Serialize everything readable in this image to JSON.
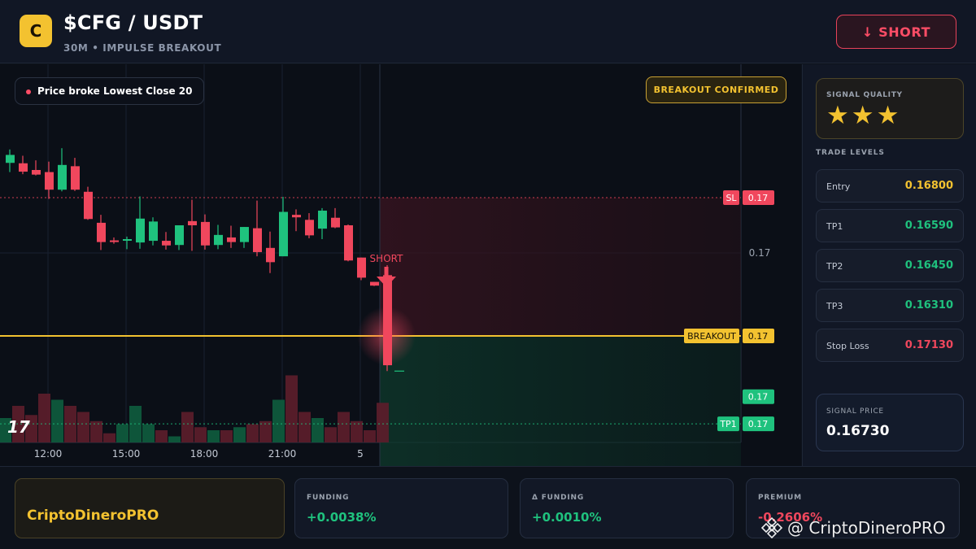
{
  "header": {
    "logo_letter": "C",
    "title": "$CFG / USDT",
    "subtitle": "30M • IMPULSE BREAKOUT",
    "short_button": "↓ SHORT"
  },
  "chart_overlay": {
    "pill_text": "Price broke Lowest Close 20",
    "confirmed_badge": "BREAKOUT CONFIRMED",
    "short_marker": "SHORT",
    "tv_logo": "17"
  },
  "colors": {
    "up": "#1fc27e",
    "down": "#f0475d",
    "breakout": "#f3c230",
    "background": "#0b0f17"
  },
  "chart_data": {
    "type": "candlestick",
    "x_ticks": [
      "12:00",
      "15:00",
      "18:00",
      "21:00",
      "5"
    ],
    "x_tick_index": [
      3,
      9,
      15,
      21,
      27
    ],
    "y_tick_label": "0.17",
    "levels": [
      {
        "name": "SL",
        "tag": "SL",
        "price_label": "0.17",
        "value": 0.1713
      },
      {
        "name": "Breakout",
        "tag": "BREAKOUT",
        "price_label": "0.17",
        "value": 0.168
      },
      {
        "name": "Last price",
        "tag": "",
        "price_label": "0.17",
        "value": 0.16655
      },
      {
        "name": "TP1",
        "tag": "TP1",
        "price_label": "0.17",
        "value": 0.1659
      }
    ],
    "candles": [
      {
        "o": 0.17213,
        "h": 0.17245,
        "l": 0.17191,
        "c": 0.17232,
        "v": 4
      },
      {
        "o": 0.17212,
        "h": 0.1723,
        "l": 0.17186,
        "c": 0.17192,
        "v": 6
      },
      {
        "o": 0.17196,
        "h": 0.17219,
        "l": 0.17183,
        "c": 0.17185,
        "v": 4.5
      },
      {
        "o": 0.17191,
        "h": 0.17216,
        "l": 0.17127,
        "c": 0.17149,
        "v": 8
      },
      {
        "o": 0.17149,
        "h": 0.17248,
        "l": 0.17145,
        "c": 0.17208,
        "v": 7
      },
      {
        "o": 0.17205,
        "h": 0.17225,
        "l": 0.17146,
        "c": 0.17149,
        "v": 6
      },
      {
        "o": 0.17144,
        "h": 0.17156,
        "l": 0.17077,
        "c": 0.17079,
        "v": 5
      },
      {
        "o": 0.1707,
        "h": 0.17089,
        "l": 0.17005,
        "c": 0.17024,
        "v": 3.5
      },
      {
        "o": 0.17028,
        "h": 0.17035,
        "l": 0.1702,
        "c": 0.17024,
        "v": 1.5
      },
      {
        "o": 0.17028,
        "h": 0.17037,
        "l": 0.17007,
        "c": 0.17031,
        "v": 3
      },
      {
        "o": 0.17023,
        "h": 0.17133,
        "l": 0.17008,
        "c": 0.1708,
        "v": 6
      },
      {
        "o": 0.17027,
        "h": 0.17083,
        "l": 0.17016,
        "c": 0.17073,
        "v": 3
      },
      {
        "o": 0.17027,
        "h": 0.17048,
        "l": 0.17006,
        "c": 0.17016,
        "v": 2
      },
      {
        "o": 0.17017,
        "h": 0.17057,
        "l": 0.17005,
        "c": 0.17064,
        "v": 1
      },
      {
        "o": 0.17074,
        "h": 0.17125,
        "l": 0.17003,
        "c": 0.17064,
        "v": 5
      },
      {
        "o": 0.17072,
        "h": 0.1709,
        "l": 0.17006,
        "c": 0.17016,
        "v": 2.5
      },
      {
        "o": 0.17017,
        "h": 0.17065,
        "l": 0.17007,
        "c": 0.17041,
        "v": 2
      },
      {
        "o": 0.17035,
        "h": 0.17063,
        "l": 0.1701,
        "c": 0.17024,
        "v": 2
      },
      {
        "o": 0.17024,
        "h": 0.1706,
        "l": 0.1701,
        "c": 0.1706,
        "v": 2.5
      },
      {
        "o": 0.17057,
        "h": 0.17123,
        "l": 0.1699,
        "c": 0.17,
        "v": 3
      },
      {
        "o": 0.1701,
        "h": 0.17049,
        "l": 0.1695,
        "c": 0.16976,
        "v": 3.5
      },
      {
        "o": 0.1699,
        "h": 0.17132,
        "l": 0.1699,
        "c": 0.17096,
        "v": 7
      },
      {
        "o": 0.17089,
        "h": 0.17102,
        "l": 0.1705,
        "c": 0.17083,
        "v": 11
      },
      {
        "o": 0.17077,
        "h": 0.17093,
        "l": 0.17033,
        "c": 0.1704,
        "v": 5
      },
      {
        "o": 0.17056,
        "h": 0.17105,
        "l": 0.17031,
        "c": 0.17099,
        "v": 4
      },
      {
        "o": 0.17082,
        "h": 0.17105,
        "l": 0.17057,
        "c": 0.17059,
        "v": 2.5
      },
      {
        "o": 0.17064,
        "h": 0.17066,
        "l": 0.16978,
        "c": 0.1698,
        "v": 5
      },
      {
        "o": 0.16987,
        "h": 0.1698,
        "l": 0.16933,
        "c": 0.16939,
        "v": 3.5
      },
      {
        "o": 0.16929,
        "h": 0.16924,
        "l": 0.16919,
        "c": 0.1692,
        "v": 2
      },
      {
        "o": 0.16945,
        "h": 0.16969,
        "l": 0.16716,
        "c": 0.1673,
        "v": 6.5
      }
    ],
    "volume_colors_note": ""
  },
  "sidebar": {
    "signal_quality_label": "SIGNAL QUALITY",
    "stars": "★★★",
    "stars_value": 3,
    "trade_levels_label": "TRADE LEVELS",
    "levels": [
      {
        "name": "Entry",
        "value": "0.16800",
        "color": "#f3c230"
      },
      {
        "name": "TP1",
        "value": "0.16590",
        "color": "#1fc27e"
      },
      {
        "name": "TP2",
        "value": "0.16450",
        "color": "#1fc27e"
      },
      {
        "name": "TP3",
        "value": "0.16310",
        "color": "#1fc27e"
      },
      {
        "name": "Stop Loss",
        "value": "0.17130",
        "color": "#f0475d"
      }
    ],
    "signal_price_label": "SIGNAL PRICE",
    "signal_price": "0.16730"
  },
  "footer": {
    "brand": "CriptoDineroPRO",
    "stats": [
      {
        "label": "FUNDING",
        "value": "+0.0038%",
        "color": "#1fc27e"
      },
      {
        "label": "Δ FUNDING",
        "value": "+0.0010%",
        "color": "#1fc27e"
      },
      {
        "label": "PREMIUM",
        "value": "-0.2606%",
        "color": "#f0475d"
      }
    ],
    "watermark": "@ CriptoDineroPRO"
  }
}
